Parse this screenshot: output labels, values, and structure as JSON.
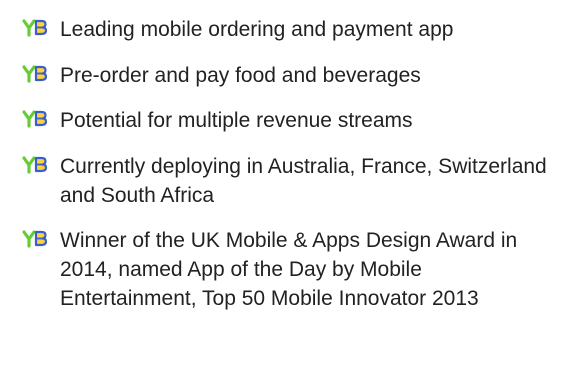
{
  "bullet": {
    "icon": "yb-logo-icon",
    "letter_y": "Y",
    "letter_b": "B",
    "colors": {
      "y": "#66cc33",
      "b": "#3a5fcd",
      "b_fill": "#ffd23a"
    }
  },
  "items": [
    {
      "text": "Leading mobile ordering and payment app"
    },
    {
      "text": "Pre-order and pay food and beverages"
    },
    {
      "text": "Potential for multiple revenue streams"
    },
    {
      "text": "Currently deploying in Australia, France, Switzerland and South Africa"
    },
    {
      "text": "Winner of the UK Mobile & Apps Design Award in 2014, named App of the Day by Mobile Entertainment, Top 50 Mobile Innovator 2013"
    }
  ]
}
